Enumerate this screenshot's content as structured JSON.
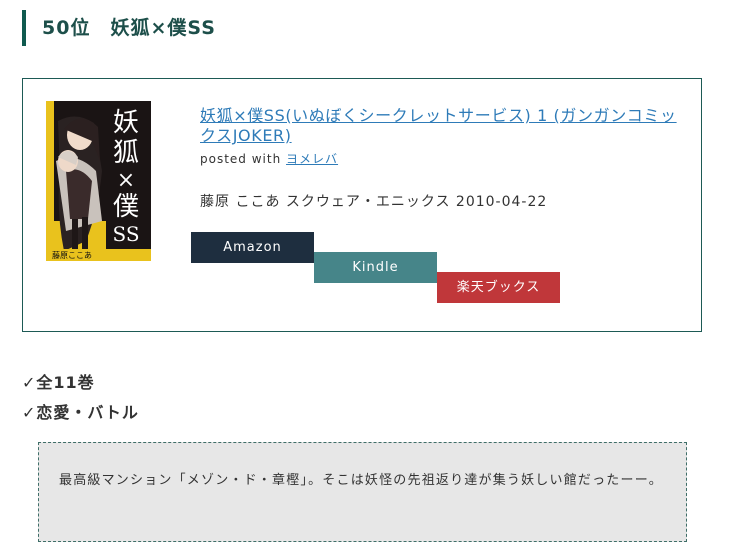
{
  "heading": {
    "rank": "50位",
    "series": "妖狐×僕SS"
  },
  "book": {
    "title": "妖狐×僕SS(いぬぼくシークレットサービス) 1 (ガンガンコミックスJOKER)",
    "posted_prefix": "posted with",
    "posted_link": "ヨメレバ",
    "meta": "藤原 ここあ スクウェア・エニックス 2010-04-22",
    "cover_text": {
      "title_chars": [
        "妖",
        "狐",
        "×",
        "僕",
        "SS"
      ],
      "author": "藤原ここあ"
    }
  },
  "buttons": {
    "amazon": "Amazon",
    "kindle": "Kindle",
    "rakuten": "楽天ブックス"
  },
  "colors": {
    "amazon": "#1e2e3f",
    "kindle": "#468589",
    "rakuten": "#c0373a",
    "accent": "#0f5a4f"
  },
  "tags": [
    "✓全11巻",
    "✓恋愛・バトル"
  ],
  "synopsis": "最高級マンション「メゾン・ド・章樫」。そこは妖怪の先祖返り達が集う妖しい館だったーー。"
}
